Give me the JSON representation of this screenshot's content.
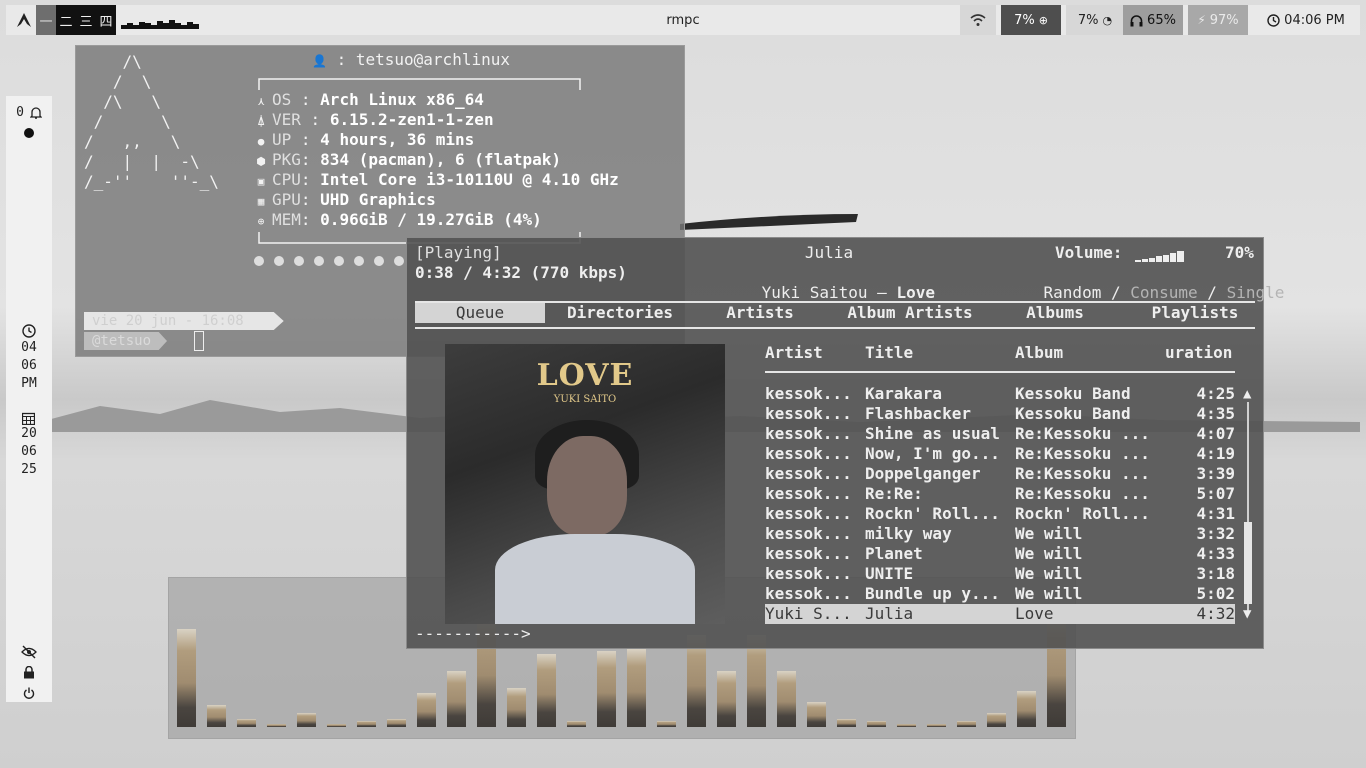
{
  "topbar": {
    "workspaces": [
      "一",
      "二",
      "三",
      "四"
    ],
    "title": "rmpc",
    "cpu": "7%",
    "mem": "7%",
    "headphones": "65%",
    "battery": "97%",
    "time": "04:06 PM"
  },
  "leftbar": {
    "notif_count": "0",
    "clock_h": "04",
    "clock_m": "06",
    "clock_ampm": "PM",
    "date_d": "20",
    "date_m": "06",
    "date_y": "25"
  },
  "fetch": {
    "ascii": "    /\\\n   /  \\\n  /\\   \\\n /      \\\n/   ,,   \\\n/   |  |  -\\\n/_-''    ''-_\\",
    "user": "tetsuo@archlinux",
    "lines": [
      {
        "key": "OS",
        "val": "Arch Linux x86_64"
      },
      {
        "key": "VER",
        "val": "6.15.2-zen1-1-zen"
      },
      {
        "key": "UP",
        "val": "4 hours, 36 mins"
      },
      {
        "key": "PKG",
        "val": "834 (pacman), 6 (flatpak)"
      },
      {
        "key": "CPU",
        "val": "Intel Core i3-10110U @ 4.10 GHz"
      },
      {
        "key": "GPU",
        "val": "UHD Graphics"
      },
      {
        "key": "MEM",
        "val": "0.96GiB / 19.27GiB (4%)"
      }
    ],
    "prompt_date": "vie 20 jun - 16:08",
    "prompt_user": "@tetsuo"
  },
  "rmpc": {
    "state": "[Playing]",
    "time": "0:38 / 4:32 (770 kbps)",
    "song": "Julia",
    "artist": "Yuki Saitou",
    "album": "Love",
    "volume_label": "Volume:",
    "volume": "70%",
    "random": "Random",
    "consume": "Consume",
    "single": "Single",
    "tabs": [
      "Queue",
      "Directories",
      "Artists",
      "Album Artists",
      "Albums",
      "Playlists"
    ],
    "cover_title": "LOVE",
    "cover_sub": "YUKI SAITO",
    "columns": [
      "Artist",
      "Title",
      "Album",
      "uration"
    ],
    "queue": [
      {
        "artist": "kessok...",
        "title": "Karakara",
        "album": "Kessoku Band",
        "dur": "4:25"
      },
      {
        "artist": "kessok...",
        "title": "Flashbacker",
        "album": "Kessoku Band",
        "dur": "4:35"
      },
      {
        "artist": "kessok...",
        "title": "Shine as usual",
        "album": "Re:Kessoku ...",
        "dur": "4:07"
      },
      {
        "artist": "kessok...",
        "title": "Now, I'm go...",
        "album": "Re:Kessoku ...",
        "dur": "4:19"
      },
      {
        "artist": "kessok...",
        "title": "Doppelganger",
        "album": "Re:Kessoku ...",
        "dur": "3:39"
      },
      {
        "artist": "kessok...",
        "title": "Re:Re:",
        "album": "Re:Kessoku ...",
        "dur": "5:07"
      },
      {
        "artist": "kessok...",
        "title": "Rockn' Roll...",
        "album": "Rockn' Roll...",
        "dur": "4:31"
      },
      {
        "artist": "kessok...",
        "title": "milky way",
        "album": "We will",
        "dur": "3:32"
      },
      {
        "artist": "kessok...",
        "title": "Planet",
        "album": "We will",
        "dur": "4:33"
      },
      {
        "artist": "kessok...",
        "title": "UNITE",
        "album": "We will",
        "dur": "3:18"
      },
      {
        "artist": "kessok...",
        "title": "Bundle up y...",
        "album": "We will",
        "dur": "5:02"
      },
      {
        "artist": "Yuki S...",
        "title": "Julia",
        "album": "Love",
        "dur": "4:32"
      }
    ],
    "progress": "----------->"
  },
  "visualizer": {
    "levels": [
      0.7,
      0.16,
      0.06,
      0.02,
      0.1,
      0.02,
      0.04,
      0.06,
      0.24,
      0.4,
      0.82,
      0.28,
      0.52,
      0.04,
      0.54,
      0.56,
      0.04,
      0.66,
      0.4,
      0.66,
      0.4,
      0.18,
      0.06,
      0.04,
      0.02,
      0.02,
      0.04,
      0.1,
      0.26,
      0.82
    ]
  }
}
